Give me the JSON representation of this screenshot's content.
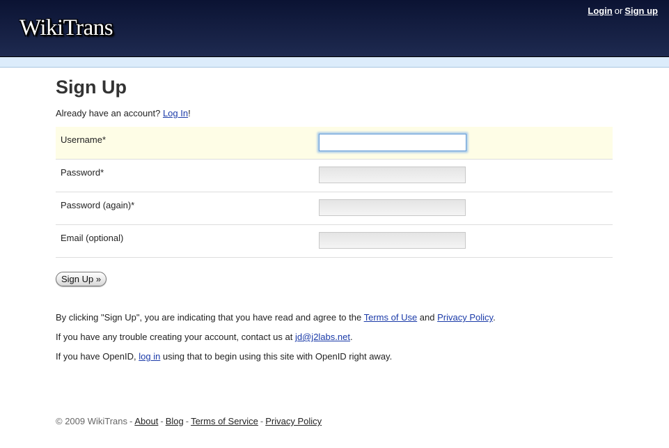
{
  "header": {
    "logo": "WikiTrans",
    "login_label": "Login",
    "or_text": "or",
    "signup_label": "Sign up"
  },
  "page": {
    "title": "Sign Up",
    "already_prefix": "Already have an account? ",
    "already_link": "Log In",
    "already_suffix": "!"
  },
  "form": {
    "fields": [
      {
        "label": "Username*",
        "value": ""
      },
      {
        "label": "Password*",
        "value": ""
      },
      {
        "label": "Password (again)*",
        "value": ""
      },
      {
        "label": "Email (optional)",
        "value": ""
      }
    ],
    "submit_label": "Sign Up »"
  },
  "info": {
    "terms_prefix": "By clicking \"Sign Up\", you are indicating that you have read and agree to the ",
    "terms_link": "Terms of Use",
    "terms_and": " and ",
    "privacy_link": "Privacy Policy",
    "terms_suffix": ".",
    "contact_prefix": "If you have any trouble creating your account, contact us at ",
    "contact_email": "jd@j2labs.net",
    "contact_suffix": ".",
    "openid_prefix": "If you have OpenID, ",
    "openid_link": "log in",
    "openid_suffix": " using that to begin using this site with OpenID right away."
  },
  "footer": {
    "copyright": "© 2009 WikiTrans",
    "links": [
      "About",
      "Blog",
      "Terms of Service",
      "Privacy Policy"
    ]
  },
  "colors": {
    "header_bg": "#0b1333",
    "subbar_bg": "#dcecfb",
    "active_row_bg": "#fefde6",
    "link": "#1a3aa8"
  }
}
